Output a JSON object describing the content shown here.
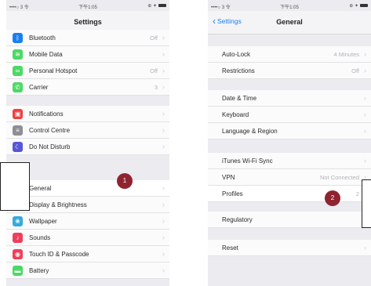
{
  "left_screen": {
    "status": {
      "carrier": "••••○ 3 令",
      "time": "下午1:05",
      "right": "⊕ ✦"
    },
    "title": "Settings",
    "items": [
      {
        "label": "Bluetooth",
        "value": "Off",
        "icon": "bluetooth-icon",
        "color": "#1a7ef5"
      },
      {
        "label": "Mobile Data",
        "value": "",
        "icon": "antenna-icon",
        "color": "#4cd964"
      },
      {
        "label": "Personal Hotspot",
        "value": "Off",
        "icon": "hotspot-icon",
        "color": "#4cd964"
      },
      {
        "label": "Carrier",
        "value": "3",
        "icon": "phone-icon",
        "color": "#4cd964"
      },
      {
        "label": "Notifications",
        "value": "",
        "icon": "notifications-icon",
        "color": "#f03e3e"
      },
      {
        "label": "Control Centre",
        "value": "",
        "icon": "control-centre-icon",
        "color": "#8e8e93"
      },
      {
        "label": "Do Not Disturb",
        "value": "",
        "icon": "moon-icon",
        "color": "#5856d6"
      },
      {
        "label": "General",
        "value": "",
        "icon": "gear-icon",
        "color": "#8e8e93"
      },
      {
        "label": "Display & Brightness",
        "value": "",
        "icon": "display-icon",
        "color": "#1a7ef5"
      },
      {
        "label": "Wallpaper",
        "value": "",
        "icon": "wallpaper-icon",
        "color": "#34aadc"
      },
      {
        "label": "Sounds",
        "value": "",
        "icon": "sounds-icon",
        "color": "#f03e5a"
      },
      {
        "label": "Touch ID & Passcode",
        "value": "",
        "icon": "fingerprint-icon",
        "color": "#f03e5a"
      },
      {
        "label": "Battery",
        "value": "",
        "icon": "battery-icon",
        "color": "#4cd964"
      }
    ],
    "badge": "1"
  },
  "right_screen": {
    "status": {
      "carrier": "••••○ 3 令",
      "time": "下午1:05",
      "right": "⊕ ✦"
    },
    "back_label": "Settings",
    "title": "General",
    "items": [
      {
        "label": "Auto-Lock",
        "value": "4 Minutes"
      },
      {
        "label": "Restrictions",
        "value": "Off"
      },
      {
        "label": "Date & Time",
        "value": ""
      },
      {
        "label": "Keyboard",
        "value": ""
      },
      {
        "label": "Language & Region",
        "value": ""
      },
      {
        "label": "iTunes Wi-Fi Sync",
        "value": ""
      },
      {
        "label": "VPN",
        "value": "Not Connected"
      },
      {
        "label": "Profiles",
        "value": "2"
      },
      {
        "label": "Regulatory",
        "value": ""
      },
      {
        "label": "Reset",
        "value": ""
      }
    ],
    "badge": "2"
  },
  "chevron": "›",
  "accent": "#1a7ef5",
  "badge_color": "#8f2430"
}
